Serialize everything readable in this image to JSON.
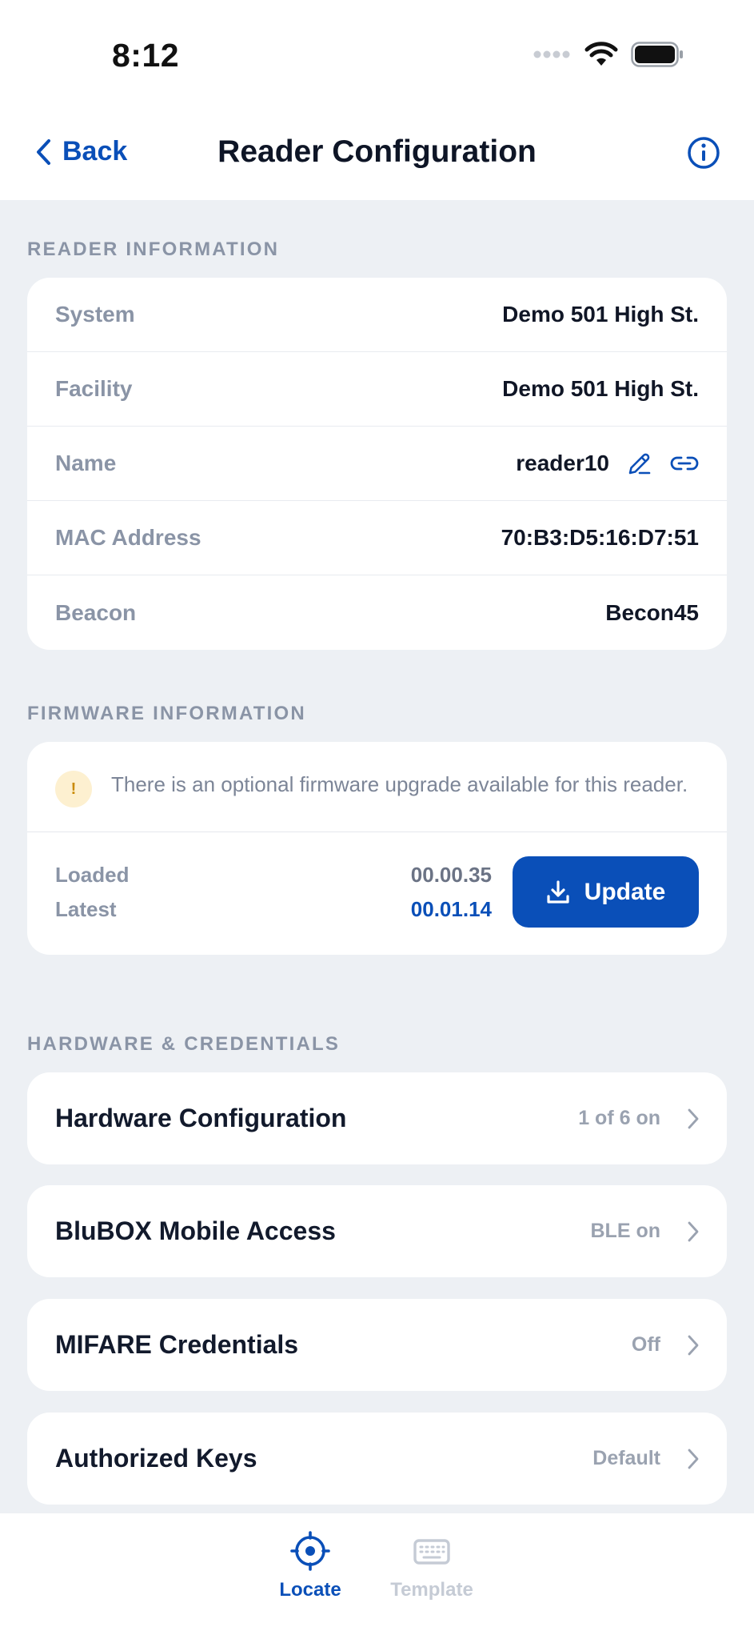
{
  "status_bar": {
    "time": "8:12"
  },
  "nav": {
    "back_label": "Back",
    "title": "Reader Configuration"
  },
  "reader_info": {
    "section_title": "READER INFORMATION",
    "rows": [
      {
        "label": "System",
        "value": "Demo 501 High St."
      },
      {
        "label": "Facility",
        "value": "Demo 501 High St."
      },
      {
        "label": "Name",
        "value": "reader10"
      },
      {
        "label": "MAC Address",
        "value": "70:B3:D5:16:D7:51"
      },
      {
        "label": "Beacon",
        "value": "Becon45"
      }
    ]
  },
  "firmware": {
    "section_title": "FIRMWARE INFORMATION",
    "notice_icon": "!",
    "notice": "There is an optional firmware upgrade available for this reader.",
    "loaded_label": "Loaded",
    "loaded_value": "00.00.35",
    "latest_label": "Latest",
    "latest_value": "00.01.14",
    "update_label": "Update"
  },
  "hardware": {
    "section_title": "HARDWARE & CREDENTIALS",
    "items": [
      {
        "title": "Hardware Configuration",
        "status": "1 of 6 on"
      },
      {
        "title": "BluBOX Mobile Access",
        "status": "BLE on"
      },
      {
        "title": "MIFARE Credentials",
        "status": "Off"
      },
      {
        "title": "Authorized Keys",
        "status": "Default"
      }
    ]
  },
  "tabs": [
    {
      "label": "Locate",
      "icon": "locate-icon",
      "active": true
    },
    {
      "label": "Template",
      "icon": "keyboard-icon",
      "active": false
    }
  ],
  "colors": {
    "accent": "#0a4fb8",
    "background": "#edf0f4",
    "muted": "#8a94a6",
    "warning_bg": "#fdf0d0",
    "inactive_tab": "#c5cbd5"
  }
}
